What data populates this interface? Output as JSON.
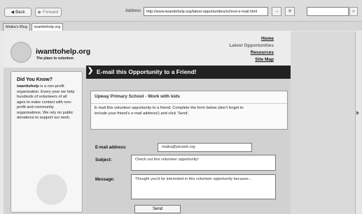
{
  "toolbar": {
    "back_label": "Back",
    "forward_label": "Forward",
    "address_label": "Address",
    "address_value": "http://www.iwanttohelp.org/latest-opportunities/school-e-mail.html"
  },
  "tabs": [
    {
      "label": "Maika's Blog"
    },
    {
      "label": "iwanttohelp.org"
    }
  ],
  "site": {
    "logo_text": "iwanttohelp.org",
    "tagline": "The place to volunteer."
  },
  "nav": {
    "home": "Home",
    "latest": "Latest Opportunities",
    "resources": "Resources",
    "sitemap": "Site Map"
  },
  "sidebar": {
    "title": "Did You Know?",
    "brand": "iwanttohelp",
    "text": " is a non-profit organisation. Every year we help hundreds of volunteers of all ages to make contact with non-profit and community organisations. We rely on public donations to support our work."
  },
  "main": {
    "title": "E-mail this Opportunity to a Friend!",
    "opp_title": "Upway Primary School - Work with kids",
    "opp_text": "E-mail this volunteer opportunity to a friend. Complete the form below (don't forget to include your friend's e-mail address!) and click 'Send'."
  },
  "form": {
    "email_label": "E-mail address:",
    "email_value": "maika@picweb.org",
    "subject_label": "Subject:",
    "subject_value": "Check out this volunteer opportunity!",
    "message_label": "Message:",
    "message_value": "Thought you'd be interested in this volunteer opportunity because...",
    "send_label": "Send"
  }
}
